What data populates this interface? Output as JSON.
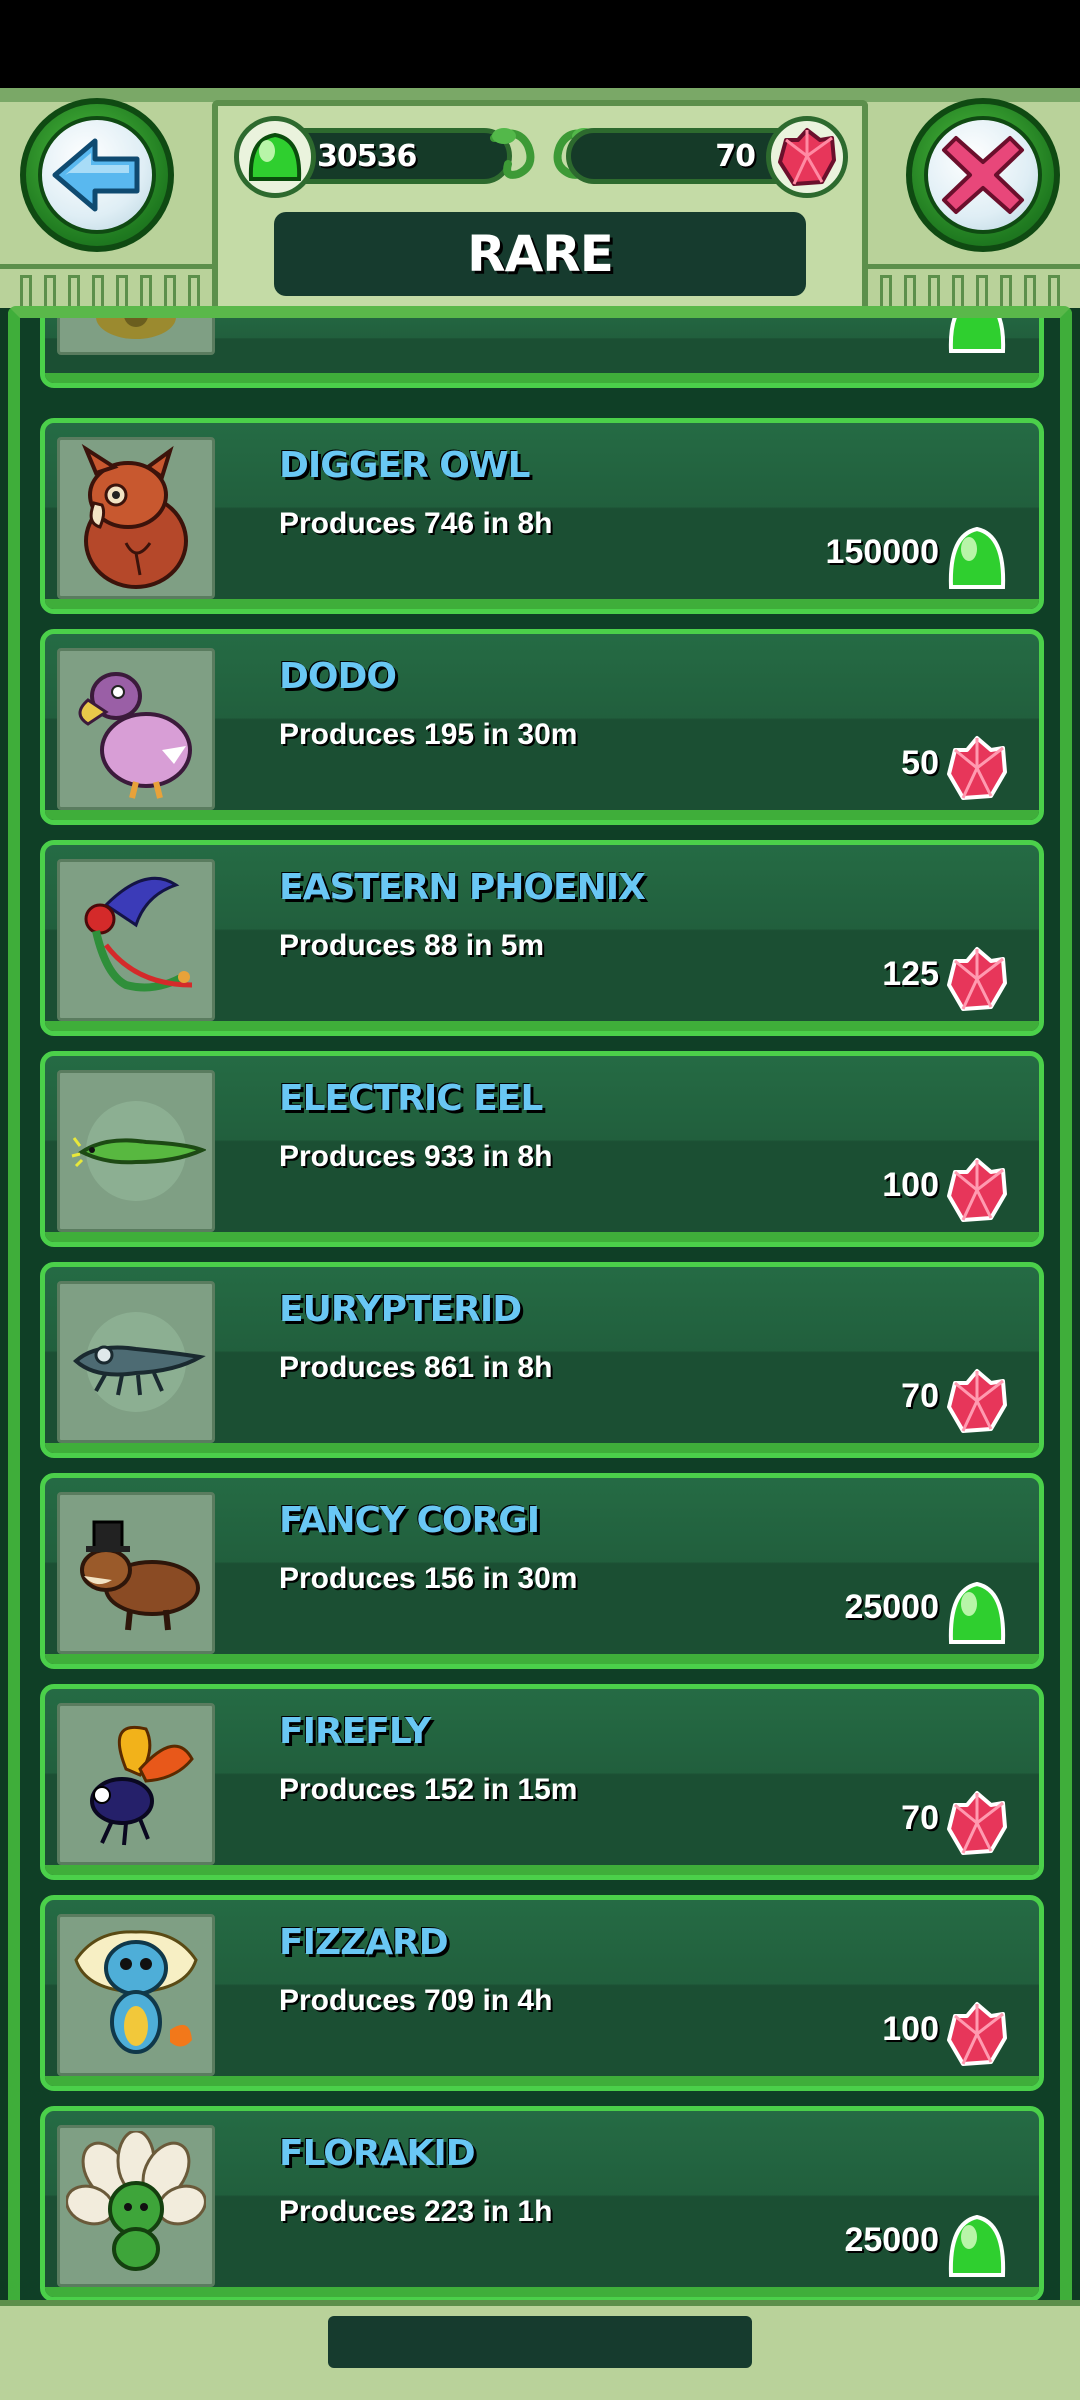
{
  "header": {
    "title": "RARE",
    "gelatin_amount": "30536",
    "gems_amount": "70",
    "back_icon": "back-arrow-icon",
    "close_icon": "close-x-icon"
  },
  "colors": {
    "name": "#69c7f4",
    "card_border": "#4bd04a",
    "gem": "#e7365a",
    "gelatin": "#2fcf2f"
  },
  "creatures": [
    {
      "name": "DIGGER OWL",
      "produces": "Produces 746 in 8h",
      "price": "150000",
      "currency": "gelatin"
    },
    {
      "name": "DODO",
      "produces": "Produces 195 in 30m",
      "price": "50",
      "currency": "gem"
    },
    {
      "name": "EASTERN PHOENIX",
      "produces": "Produces 88 in 5m",
      "price": "125",
      "currency": "gem"
    },
    {
      "name": "ELECTRIC EEL",
      "produces": "Produces 933 in 8h",
      "price": "100",
      "currency": "gem"
    },
    {
      "name": "EURYPTERID",
      "produces": "Produces 861 in 8h",
      "price": "70",
      "currency": "gem"
    },
    {
      "name": "FANCY CORGI",
      "produces": "Produces 156 in 30m",
      "price": "25000",
      "currency": "gelatin"
    },
    {
      "name": "FIREFLY",
      "produces": "Produces 152 in 15m",
      "price": "70",
      "currency": "gem"
    },
    {
      "name": "FIZZARD",
      "produces": "Produces 709 in 4h",
      "price": "100",
      "currency": "gem"
    },
    {
      "name": "FLORAKID",
      "produces": "Produces 223 in 1h",
      "price": "25000",
      "currency": "gelatin"
    }
  ]
}
